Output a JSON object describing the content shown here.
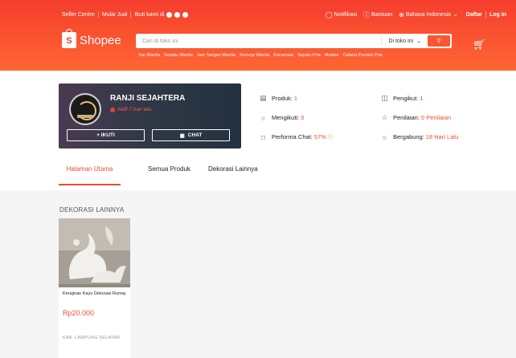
{
  "topbar": {
    "seller_centre": "Seller Centre",
    "start_selling": "Mulai Jual",
    "follow_us": "Ikuti kami di",
    "notifications": "Notifikasi",
    "help": "Bantuan",
    "language": "Bahasa Indonesia",
    "register": "Daftar",
    "login": "Log In"
  },
  "header": {
    "brand": "Shopee",
    "search_placeholder": "Cari di toko ini",
    "search_scope": "Di toko ini",
    "keywords": [
      "Tas Wanita",
      "Sepatu Wanita",
      "Jam Tangan Wanita",
      "Kemeja Wanita",
      "Kacamata",
      "Sepatu Pria",
      "Masker",
      "Celana Pendek Pria"
    ]
  },
  "shop": {
    "name": "RANJI SEJAHTERA",
    "status": "Aktif 7 hari lalu",
    "follow_label": "+ IKUTI",
    "chat_label": "CHAT"
  },
  "stats": {
    "products_label": "Produk:",
    "products_value": "1",
    "following_label": "Mengikuti:",
    "following_value": "0",
    "chat_perf_label": "Performa Chat:",
    "chat_perf_value": "57%",
    "followers_label": "Pengikut:",
    "followers_value": "1",
    "rating_label": "Penilaian:",
    "rating_value": "0 Penilaian",
    "joined_label": "Bergabung:",
    "joined_value": "18 Hari Lalu"
  },
  "tabs": [
    "Halaman Utama",
    "Semua Produk",
    "Dekorasi Lainnya"
  ],
  "section_title": "DEKORASI LAINNYA",
  "product": {
    "name": "Kerajinan Kayu Dekorasi Rumaj",
    "price": "Rp20.000",
    "location": "KAB. LAMPUNG SELATAN"
  },
  "colors": {
    "brand": "#ee4d2d",
    "header": "#f53d2d"
  }
}
